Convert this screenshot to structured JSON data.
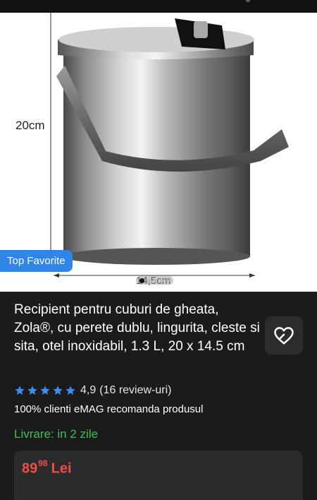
{
  "gallery": {
    "dimension_height": "20cm",
    "dimension_width": "14,5cm",
    "badge": "Top Favorite",
    "carousel_dots": 5,
    "active_dot": 0
  },
  "product": {
    "title": "Recipient pentru cuburi de gheata, Zola®, cu perete dublu, lingurita, cleste si sita, otel inoxidabil, 1.3 L, 20 x 14.5 cm",
    "rating": {
      "stars": 5,
      "score": "4,9",
      "reviews": "(16 review-uri)"
    },
    "recommendation": "100% clienti eMAG recomanda produsul",
    "delivery": "Livrare: in 2 zile",
    "price": {
      "integer": "89",
      "decimals": "98",
      "currency": "Lei"
    }
  },
  "colors": {
    "background": "#1b1b1b",
    "badge": "#2f86e8",
    "star": "#3b8df0",
    "delivery": "#3fbf57",
    "price": "#f04d4d"
  },
  "icons": {
    "favorite": "heart-outline-icon",
    "rating": "star-icon"
  }
}
